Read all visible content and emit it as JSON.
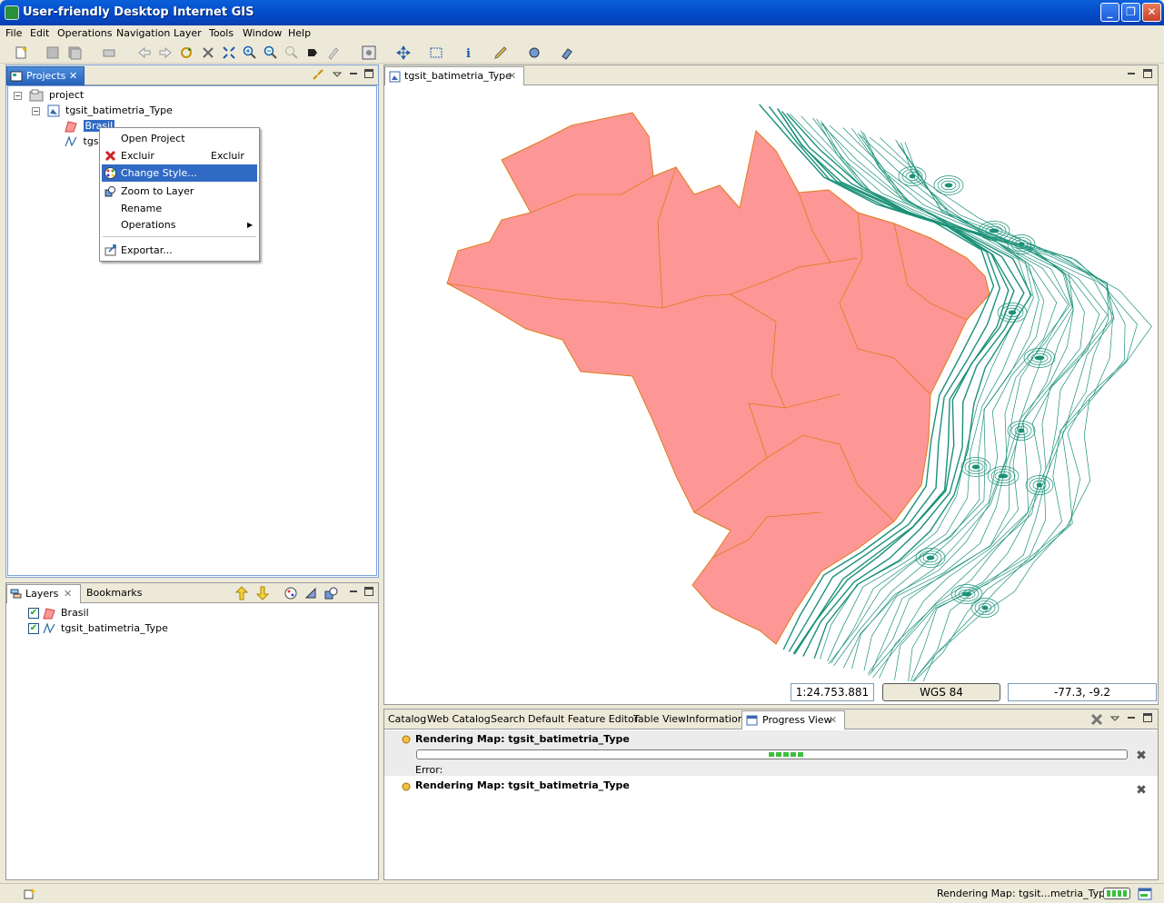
{
  "window": {
    "title": "User-friendly Desktop Internet GIS"
  },
  "menu": [
    "File",
    "Edit",
    "Operations",
    "Navigation",
    "Layer",
    "Tools",
    "Window",
    "Help"
  ],
  "projects_panel": {
    "tab_label": "Projects",
    "tree": {
      "root": "project",
      "map": "tgsit_batimetria_Type",
      "layer1": "Brasil",
      "layer2": "tgsit"
    }
  },
  "context_menu": {
    "items": [
      {
        "label": "Open Project",
        "shortcut": ""
      },
      {
        "label": "Excluir",
        "shortcut": "Excluir"
      },
      {
        "label": "Change Style...",
        "shortcut": ""
      },
      {
        "label": "Zoom to Layer",
        "shortcut": ""
      },
      {
        "label": "Rename",
        "shortcut": ""
      },
      {
        "label": "Operations",
        "shortcut": ""
      },
      {
        "label": "Exportar...",
        "shortcut": ""
      }
    ]
  },
  "layers_panel": {
    "tabs": [
      "Layers",
      "Bookmarks"
    ],
    "items": [
      {
        "label": "Brasil",
        "checked": true
      },
      {
        "label": "tgsit_batimetria_Type",
        "checked": true
      }
    ]
  },
  "map_editor": {
    "tab_label": "tgsit_batimetria_Type",
    "scale": "1:24.753.881",
    "crs": "WGS 84",
    "coords": "-77.3, -9.2",
    "colors": {
      "land": "#fd9795",
      "land_border": "#e07a1a",
      "contour": "#1a9178"
    }
  },
  "bottom_panel": {
    "tabs": [
      "Catalog",
      "Web Catalog",
      "Search",
      "Default Feature Editor",
      "Table View",
      "Information",
      "Progress View"
    ],
    "jobs": [
      {
        "title": "Rendering Map: tgsit_batimetria_Type",
        "error_label": "Error:"
      },
      {
        "title": "Rendering Map: tgsit_batimetria_Type"
      }
    ]
  },
  "statusbar": {
    "message": "Rendering Map: tgsit...metria_Type"
  }
}
